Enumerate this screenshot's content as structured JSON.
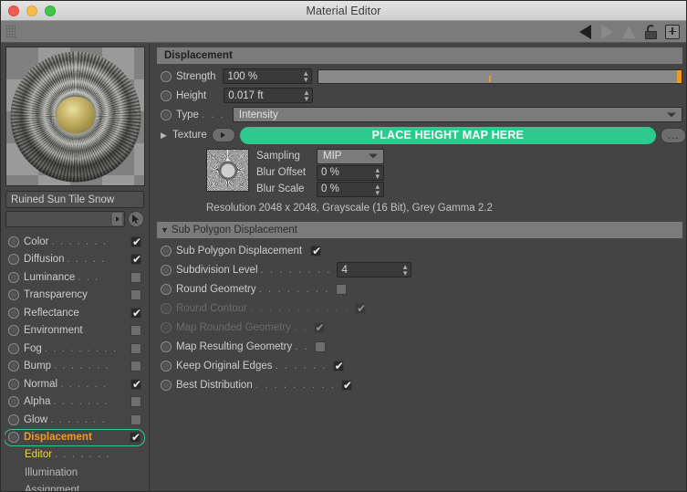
{
  "window": {
    "title": "Material Editor"
  },
  "toolbar": {
    "icons": [
      "grip-handle",
      "back-arrow",
      "forward-arrow",
      "up-arrow",
      "lock-icon",
      "plus-button"
    ]
  },
  "left_panel": {
    "material_name": "Ruined Sun Tile Snow",
    "search_value": "",
    "channels": [
      {
        "label": "Color",
        "dots": ". . . . . . .",
        "checked": true,
        "marker": false
      },
      {
        "label": "Diffusion",
        "dots": ". . . . .",
        "checked": true,
        "marker": true
      },
      {
        "label": "Luminance",
        "dots": ". . .",
        "checked": false,
        "marker": false
      },
      {
        "label": "Transparency",
        "dots": "",
        "checked": false,
        "marker": false
      },
      {
        "label": "Reflectance",
        "dots": "",
        "checked": true,
        "marker": false
      },
      {
        "label": "Environment",
        "dots": "",
        "checked": false,
        "marker": false
      },
      {
        "label": "Fog",
        "dots": ". . . . . . . . .",
        "checked": false,
        "marker": false
      },
      {
        "label": "Bump",
        "dots": ". . . . . . .",
        "checked": false,
        "marker": false
      },
      {
        "label": "Normal",
        "dots": ". . . . . .",
        "checked": true,
        "marker": true
      },
      {
        "label": "Alpha",
        "dots": ". . . . . . .",
        "checked": false,
        "marker": false
      },
      {
        "label": "Glow",
        "dots": ". . . . . . .",
        "checked": false,
        "marker": false
      },
      {
        "label": "Displacement",
        "dots": "",
        "checked": true,
        "marker": false,
        "selected": true
      }
    ],
    "sub_items": [
      {
        "label": "Editor",
        "dots": ". . . . . . .",
        "style": "editor"
      },
      {
        "label": "Illumination",
        "dots": "",
        "style": "plain"
      },
      {
        "label": "Assignment",
        "dots": "",
        "style": "plain"
      }
    ]
  },
  "displacement": {
    "section_title": "Displacement",
    "strength": {
      "label": "Strength",
      "value": "100 %",
      "slider_percent": 100,
      "tick_percent": 47
    },
    "height": {
      "label": "Height",
      "value": "0.017 ft"
    },
    "type": {
      "label": "Type",
      "dots": ". . .",
      "value": "Intensity"
    },
    "texture": {
      "label": "Texture",
      "banner_text": "PLACE HEIGHT MAP HERE",
      "more_button": "...",
      "banner_color": "#2ec98c"
    },
    "sampling": {
      "label": "Sampling",
      "value": "MIP"
    },
    "blur_offset": {
      "label": "Blur Offset",
      "value": "0 %"
    },
    "blur_scale": {
      "label": "Blur Scale",
      "value": "0 %"
    },
    "resolution_info": "Resolution 2048 x 2048, Grayscale (16 Bit), Grey Gamma 2.2"
  },
  "sub_polygon": {
    "section_title": "Sub Polygon Displacement",
    "rows": [
      {
        "label": "Sub Polygon Displacement",
        "dots": "",
        "type": "check",
        "checked": true,
        "disabled": false
      },
      {
        "label": "Subdivision Level",
        "dots": ". . . . . . . .",
        "type": "num",
        "value": "4",
        "disabled": false
      },
      {
        "label": "Round Geometry",
        "dots": ". . . . . . . .",
        "type": "check",
        "checked": false,
        "disabled": false
      },
      {
        "label": "Round Contour",
        "dots": ". . . . . . . . . . .",
        "type": "check",
        "checked": true,
        "disabled": true
      },
      {
        "label": "Map Rounded Geometry",
        "dots": ". .",
        "type": "check",
        "checked": true,
        "disabled": true
      },
      {
        "label": "Map Resulting Geometry",
        "dots": ". .",
        "type": "check",
        "checked": false,
        "disabled": false
      },
      {
        "label": "Keep Original Edges",
        "dots": ". . . . . .",
        "type": "check",
        "checked": true,
        "disabled": false
      },
      {
        "label": "Best Distribution",
        "dots": ". . . . . . . . .",
        "type": "check",
        "checked": true,
        "disabled": false
      }
    ]
  },
  "colors": {
    "accent_green": "#2ec98c",
    "accent_orange": "#f09a24",
    "editor_yellow": "#e8d44a"
  }
}
